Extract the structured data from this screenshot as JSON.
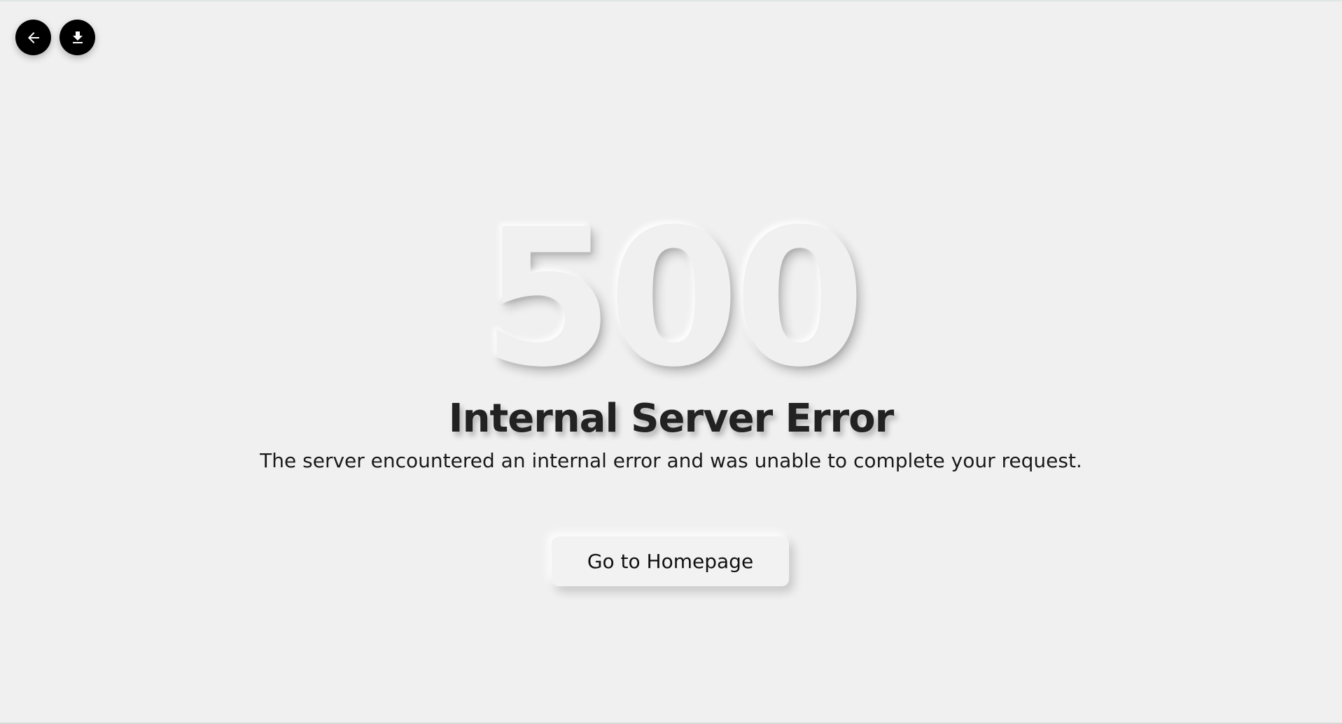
{
  "controls": {
    "back_icon": "arrow-left-icon",
    "download_icon": "download-icon"
  },
  "error": {
    "code": "500",
    "title": "Internal Server Error",
    "description": "The server encountered an internal error and was unable to complete your request."
  },
  "actions": {
    "home_label": "Go to Homepage"
  },
  "colors": {
    "background": "#f0f0f0",
    "button_dark": "#000000",
    "text": "#222222"
  }
}
